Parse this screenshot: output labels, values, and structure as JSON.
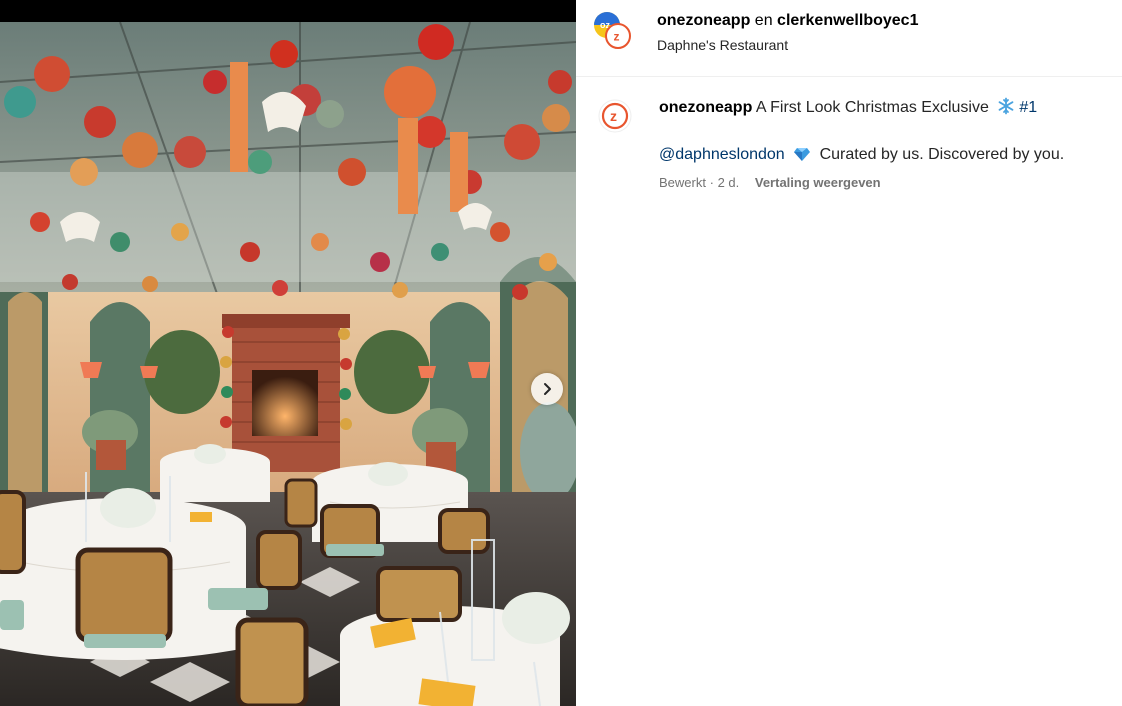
{
  "post": {
    "author": "onezoneapp",
    "conjunction": "en",
    "collaborator": "clerkenwellboyec1",
    "location": "Daphne's Restaurant"
  },
  "caption": {
    "author": "onezoneapp",
    "text": "A First Look Christmas Exclusive",
    "snow_emoji": "snowflake-icon",
    "hashtag": "#1",
    "mention": "@daphneslondon",
    "diamond_emoji": "gem-icon",
    "tagline": "Curated by us. Discovered by you."
  },
  "meta": {
    "edited": "Bewerkt",
    "separator": "·",
    "age": "2 d.",
    "translate": "Vertaling weergeven"
  },
  "media": {
    "next_icon": "chevron-right-icon",
    "photo": "restaurant-christmas-decor-photo"
  },
  "colors": {
    "link": "#00376b",
    "secondary_text": "#737373",
    "brand_orange": "#e8552e",
    "brand_yellow": "#f6c51b",
    "brand_blue": "#2a6fd6"
  }
}
